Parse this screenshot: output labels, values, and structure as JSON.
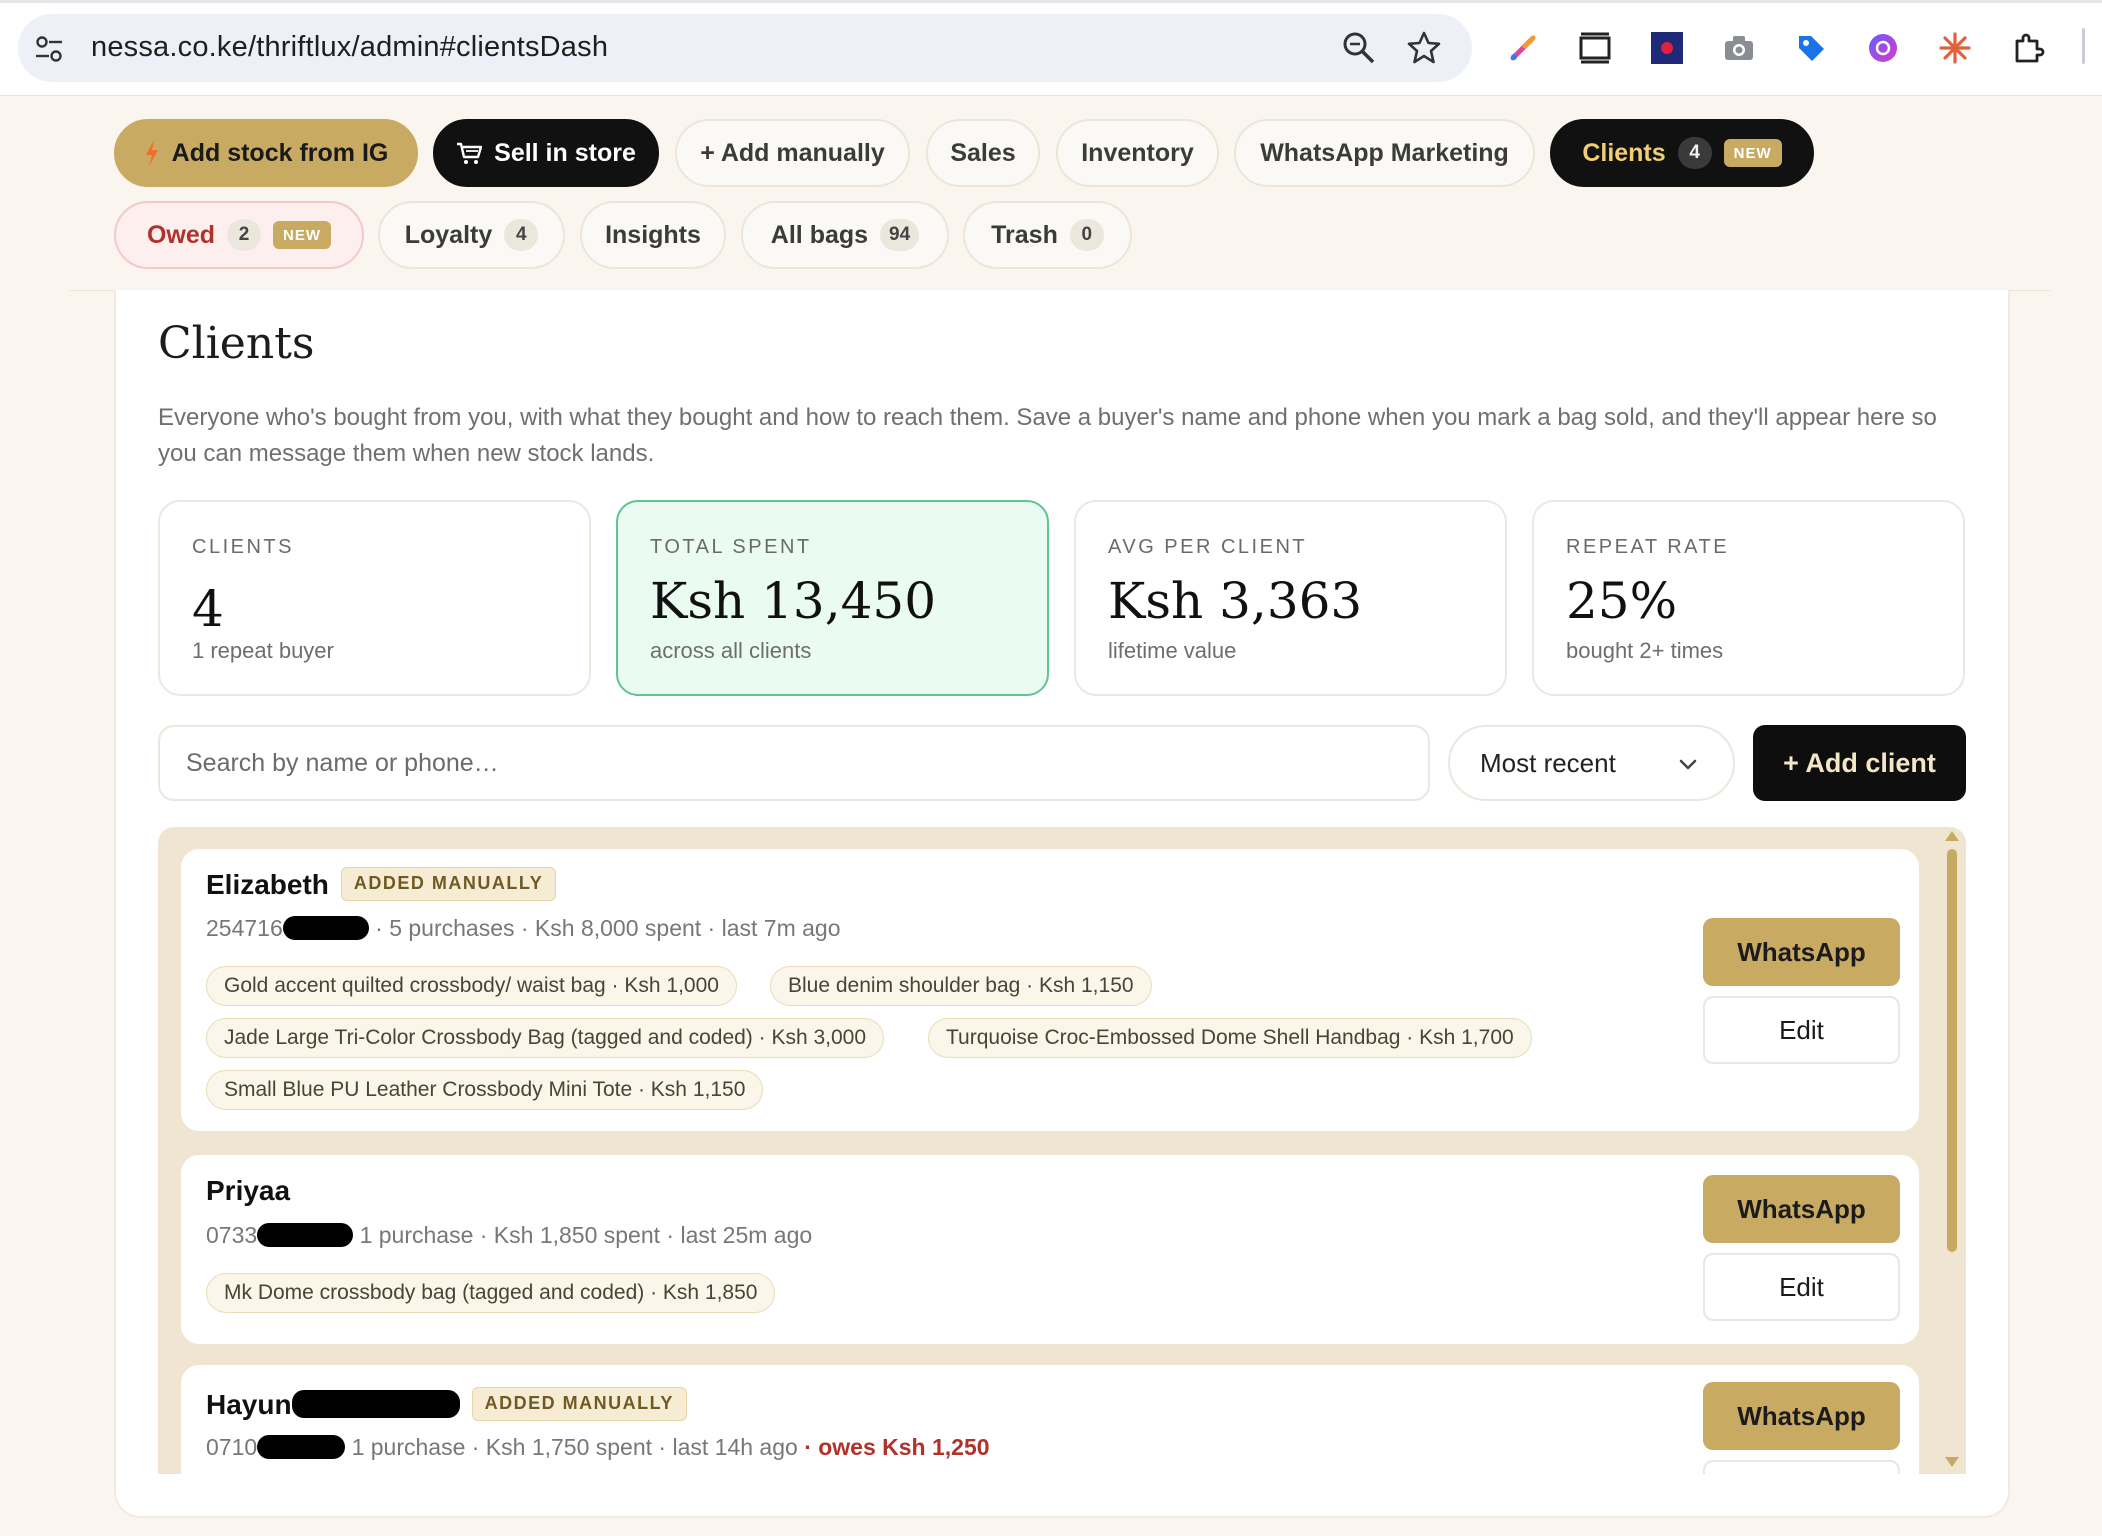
{
  "browser": {
    "url": "nessa.co.ke/thriftlux/admin#clientsDash",
    "icons": [
      "tune-icon",
      "zoom-icon",
      "star-icon"
    ],
    "extensions": [
      "color-picker-extension-icon",
      "screenshot-extension-icon",
      "screen-recorder-extension-icon",
      "camera-extension-icon",
      "tag-extension-icon",
      "gradient-extension-icon",
      "sparkle-extension-icon",
      "puzzle-extension-icon"
    ]
  },
  "nav": {
    "add_ig": "Add stock from IG",
    "sell_store": "Sell in store",
    "add_manual": "+ Add manually",
    "sales": "Sales",
    "inventory": "Inventory",
    "whatsapp_marketing": "WhatsApp Marketing",
    "clients": {
      "label": "Clients",
      "count": "4",
      "badge": "NEW"
    },
    "owed": {
      "label": "Owed",
      "count": "2",
      "badge": "NEW"
    },
    "loyalty": {
      "label": "Loyalty",
      "count": "4"
    },
    "insights": "Insights",
    "all_bags": {
      "label": "All bags",
      "count": "94"
    },
    "trash": {
      "label": "Trash",
      "count": "0"
    }
  },
  "page": {
    "title": "Clients",
    "description": "Everyone who's bought from you, with what they bought and how to reach them. Save a buyer's name and phone when you mark a bag sold, and they'll appear here so you can message them when new stock lands."
  },
  "stats": [
    {
      "label": "CLIENTS",
      "value": "4",
      "sub": "1 repeat buyer"
    },
    {
      "label": "TOTAL SPENT",
      "value": "Ksh 13,450",
      "sub": "across all clients"
    },
    {
      "label": "AVG PER CLIENT",
      "value": "Ksh 3,363",
      "sub": "lifetime value"
    },
    {
      "label": "REPEAT RATE",
      "value": "25%",
      "sub": "bought 2+ times"
    }
  ],
  "toolbar": {
    "search_placeholder": "Search by name or phone…",
    "sort_value": "Most recent",
    "add_client": "+ Add client"
  },
  "clients": [
    {
      "name": "Elizabeth",
      "tag": "ADDED MANUALLY",
      "phone_prefix": "254716",
      "meta": "· 5 purchases · Ksh 8,000 spent · last 7m ago",
      "items": [
        "Gold accent quilted crossbody/ waist bag · Ksh 1,000",
        "Blue denim shoulder bag · Ksh 1,150",
        "Jade Large Tri-Color Crossbody Bag (tagged and coded) · Ksh 3,000",
        "Turquoise Croc-Embossed Dome Shell Handbag · Ksh 1,700",
        "Small Blue PU Leather Crossbody Mini Tote · Ksh 1,150"
      ],
      "whatsapp": "WhatsApp",
      "edit": "Edit"
    },
    {
      "name": "Priyaa",
      "phone_prefix": "0733",
      "meta": "1 purchase · Ksh 1,850 spent · last 25m ago",
      "items": [
        "Mk Dome crossbody bag (tagged and coded) · Ksh 1,850"
      ],
      "whatsapp": "WhatsApp",
      "edit": "Edit"
    },
    {
      "name": "Hayun",
      "tag": "ADDED MANUALLY",
      "phone_prefix": "0710",
      "meta": "1 purchase · Ksh 1,750 spent · last 14h ago",
      "owes": "· owes Ksh 1,250",
      "whatsapp": "WhatsApp"
    }
  ],
  "colors": {
    "gold": "#c8aa62",
    "dark": "#111111",
    "owed_red": "#b0322b",
    "highlight_green": "#eafbf1"
  }
}
